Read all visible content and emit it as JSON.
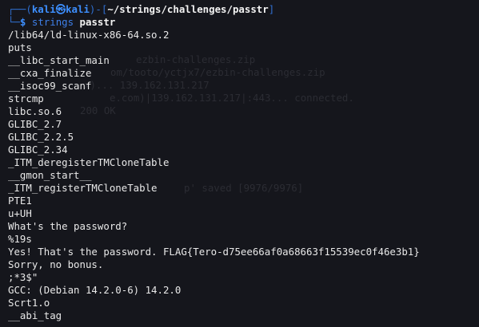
{
  "prompt": {
    "user": "kali",
    "symbol": "㉿",
    "host": "kali",
    "path": "~/strings/challenges/passtr",
    "dollar": "$",
    "command": "strings",
    "argument": "passtr"
  },
  "output_lines": [
    "/lib64/ld-linux-x86-64.so.2",
    "puts",
    "__libc_start_main",
    "__cxa_finalize",
    "__isoc99_scanf",
    "strcmp",
    "libc.so.6",
    "GLIBC_2.7",
    "GLIBC_2.2.5",
    "GLIBC_2.34",
    "_ITM_deregisterTMCloneTable",
    "__gmon_start__",
    "_ITM_registerTMCloneTable",
    "PTE1",
    "u+UH",
    "What's the password?",
    "%19s",
    "Yes! That's the password. FLAG{Tero-d75ee66af0a68663f15539ec0f46e3b1}",
    "Sorry, no bonus.",
    ";*3$\"",
    "GCC: (Debian 14.2.0-6) 14.2.0",
    "Scrt1.o",
    "__abi_tag"
  ],
  "background_ghost_lines": [
    "ezbin-challenges.zip",
    "om/tooto/yctjx7/ezbin-challenges.zip",
    "x)... 139.162.131.217",
    "e.com)|139.162.131.217|:443... connected.",
    "200 OK",
    "p' saved [9976/9976]"
  ]
}
